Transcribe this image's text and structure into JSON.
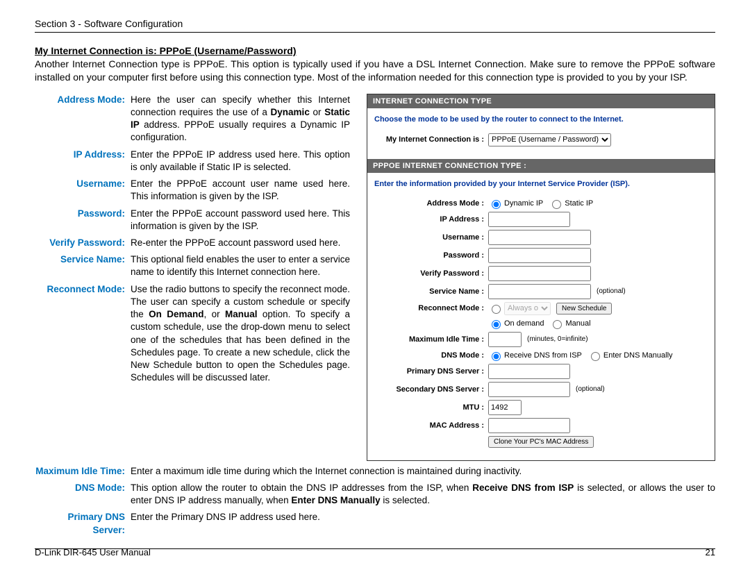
{
  "header": "Section 3 - Software Configuration",
  "footer_left": "D-Link DIR-645 User Manual",
  "footer_right": "21",
  "title": "My Internet Connection is: PPPoE (Username/Password)",
  "intro": "Another Internet Connection type is PPPoE. This option is typically used if you have a DSL Internet Connection. Make sure to remove the PPPoE software installed on your computer first before using this connection type. Most of the information needed for this connection type is provided to you by your ISP.",
  "defs": {
    "address_mode_l": "Address Mode:",
    "address_mode_t_a": "Here the user can specify whether this Internet connection requires the use of a ",
    "address_mode_t_b": "Dynamic",
    "address_mode_t_c": " or ",
    "address_mode_t_d": "Static IP",
    "address_mode_t_e": " address. PPPoE usually requires a Dynamic IP configuration.",
    "ip_l": "IP Address:",
    "ip_t": "Enter the PPPoE IP address used here. This option is only available if Static IP is selected.",
    "user_l": "Username:",
    "user_t": "Enter the PPPoE account user name used here. This information is given by the ISP.",
    "pass_l": "Password:",
    "pass_t": "Enter the PPPoE account password used here. This information is given by the ISP.",
    "vpass_l": "Verify Password:",
    "vpass_t": "Re-enter the PPPoE account password used here.",
    "svc_l": "Service Name:",
    "svc_t": "This optional field enables the user to enter a service name to identify this Internet connection here.",
    "recon_l": "Reconnect Mode:",
    "recon_t_a": "Use the radio buttons to specify the reconnect mode. The user can specify a custom schedule or specify the ",
    "recon_t_b": "On Demand",
    "recon_t_c": ", or ",
    "recon_t_d": "Manual",
    "recon_t_e": " option. To specify a custom schedule, use the drop-down menu to select one of the schedules that has been defined in the Schedules page. To create a new schedule, click the New Schedule button to open the Schedules page. Schedules will be discussed later.",
    "idle_l": "Maximum Idle Time:",
    "idle_t": "Enter a maximum idle time during which the Internet connection is maintained during inactivity.",
    "dns_l": "DNS Mode:",
    "dns_t_a": "This option allow the router to obtain the DNS IP addresses from the ISP, when ",
    "dns_t_b": "Receive DNS from ISP",
    "dns_t_c": " is selected, or allows the user to enter DNS IP address manually, when ",
    "dns_t_d": "Enter DNS Manually",
    "dns_t_e": " is selected.",
    "pdns_l": "Primary DNS Server:",
    "pdns_t": "Enter the Primary DNS IP address used here."
  },
  "panel": {
    "h1": "INTERNET CONNECTION TYPE",
    "note1": "Choose the mode to be used by the router to connect to the Internet.",
    "conn_label": "My Internet Connection is :",
    "conn_value": "PPPoE (Username / Password)",
    "h2": "PPPOE INTERNET CONNECTION TYPE :",
    "note2": "Enter the information provided by your Internet Service Provider (ISP).",
    "labels": {
      "addr": "Address Mode :",
      "ip": "IP Address :",
      "user": "Username :",
      "pass": "Password :",
      "vpass": "Verify Password :",
      "svc": "Service Name :",
      "recon": "Reconnect Mode :",
      "idle": "Maximum Idle Time :",
      "dnsmode": "DNS Mode :",
      "pdns": "Primary DNS Server :",
      "sdns": "Secondary DNS Server :",
      "mtu": "MTU :",
      "mac": "MAC Address :"
    },
    "radios": {
      "dyn": "Dynamic IP",
      "stat": "Static IP",
      "ondemand": "On demand",
      "manual": "Manual",
      "dnsisp": "Receive DNS from ISP",
      "dnsman": "Enter DNS Manually"
    },
    "mtu_value": "1492",
    "optional": "(optional)",
    "idle_hint": "(minutes, 0=infinite)",
    "always_opt": "Always o",
    "newsched_btn": "New Schedule",
    "clone_btn": "Clone Your PC's MAC Address"
  }
}
